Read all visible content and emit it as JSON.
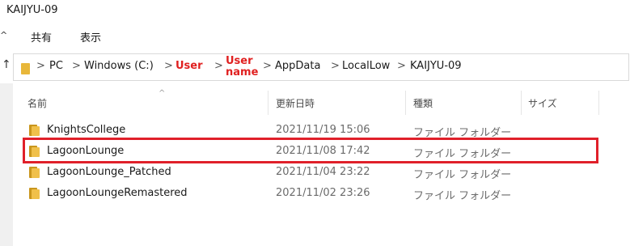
{
  "window": {
    "title": "KAIJYU-09"
  },
  "ribbon": {
    "tabs": [
      "共有",
      "表示"
    ]
  },
  "address": {
    "crumbs": [
      "PC",
      "Windows (C:)",
      "User",
      "User name",
      "AppData",
      "LocalLow",
      "KAIJYU-09"
    ],
    "redacted_color": "#e02020"
  },
  "columns": [
    "名前",
    "更新日時",
    "種類",
    "サイズ"
  ],
  "rows": [
    {
      "name": "KnightsCollege",
      "date": "2021/11/19 15:06",
      "type": "ファイル フォルダー"
    },
    {
      "name": "LagoonLounge",
      "date": "2021/11/08 17:42",
      "type": "ファイル フォルダー"
    },
    {
      "name": "LagoonLounge_Patched",
      "date": "2021/11/04 23:22",
      "type": "ファイル フォルダー"
    },
    {
      "name": "LagoonLoungeRemastered",
      "date": "2021/11/02 23:26",
      "type": "ファイル フォルダー"
    }
  ],
  "highlight_color": "#e0202a"
}
